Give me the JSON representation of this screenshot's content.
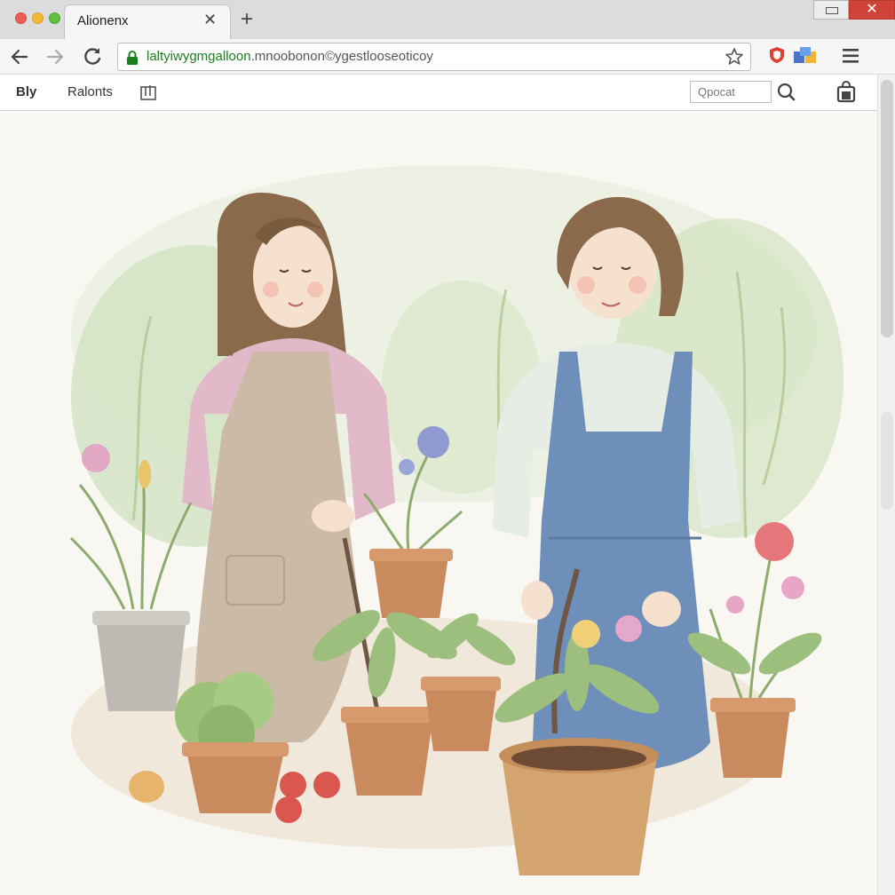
{
  "window": {
    "close_label": "✕"
  },
  "tab": {
    "title": "Alionenx",
    "close_glyph": "✕",
    "new_tab_glyph": "+"
  },
  "address_bar": {
    "url_domain": "laltyiwygmgalloon",
    "url_path": ".mnoobonon©ygestlooseoticoy"
  },
  "toolbar": {
    "logo": "Bly",
    "nav_link": "Ralonts",
    "search_placeholder": "Qpocat"
  },
  "icons": {
    "back": "arrow-left-icon",
    "forward": "arrow-right-icon",
    "reload": "reload-icon",
    "lock": "lock-icon",
    "star": "star-icon",
    "shield_ext": "shield-icon",
    "puzzle_ext": "puzzle-icon",
    "menu": "hamburger-icon",
    "bookmark": "bookmark-icon",
    "search": "search-icon",
    "cart": "bag-icon"
  },
  "colors": {
    "secure": "#1b7f20",
    "close_button": "#d04437",
    "apron_left": "#cbbba6",
    "apron_right": "#6e8fb9",
    "pot": "#c98a5e"
  }
}
